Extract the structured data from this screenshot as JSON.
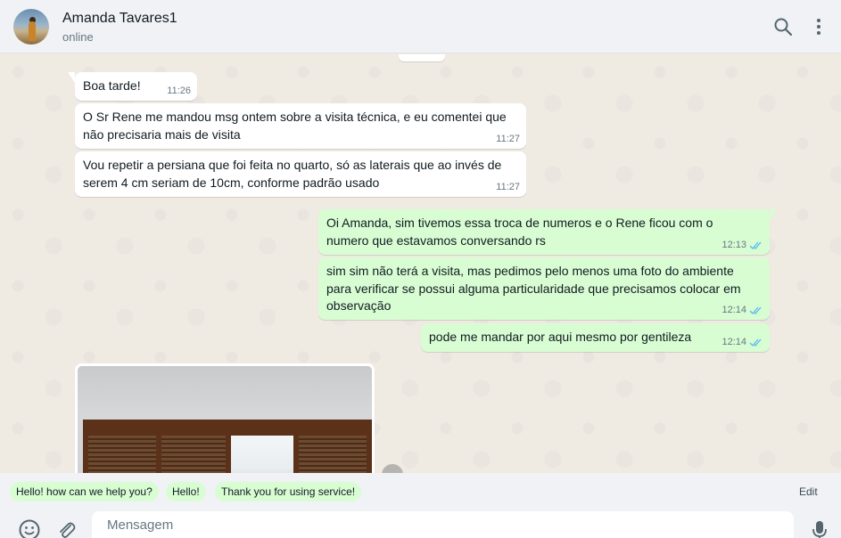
{
  "header": {
    "contact_name": "Amanda Tavares1",
    "status": "online",
    "avatar_icon": "avatar-photo",
    "search_icon": "search-icon",
    "menu_icon": "menu-icon"
  },
  "messages": [
    {
      "direction": "in",
      "text": "Boa tarde!",
      "time": "11:26"
    },
    {
      "direction": "in",
      "text": "O Sr Rene me mandou msg ontem sobre a visita técnica, e eu comentei que não precisaria mais de visita",
      "time": "11:27"
    },
    {
      "direction": "in",
      "text": "Vou repetir a persiana que foi feita no quarto, só as laterais que ao invés de serem 4 cm seriam de 10cm, conforme padrão usado",
      "time": "11:27"
    },
    {
      "direction": "out",
      "text": "Oi Amanda, sim tivemos essa troca de numeros e o Rene ficou com o numero que estavamos conversando rs",
      "time": "12:13",
      "status": "read"
    },
    {
      "direction": "out",
      "text": "sim sim não terá a visita, mas pedimos pelo menos uma foto do ambiente para verificar se possui alguma particularidade que precisamos colocar em observação",
      "time": "12:14",
      "status": "read"
    },
    {
      "direction": "out",
      "text": "pode me mandar por aqui mesmo por gentileza",
      "time": "12:14",
      "status": "read"
    },
    {
      "direction": "in",
      "type": "image"
    }
  ],
  "quick_replies": {
    "items": [
      "Hello! how can we help you?",
      "Hello!",
      "Thank you for using service!"
    ],
    "edit_label": "Edit"
  },
  "composer": {
    "placeholder": "Mensagem"
  },
  "colors": {
    "incoming_bubble": "#ffffff",
    "outgoing_bubble": "#d9fdd3",
    "read_ticks": "#53bdeb",
    "chat_background": "#efeae2"
  }
}
